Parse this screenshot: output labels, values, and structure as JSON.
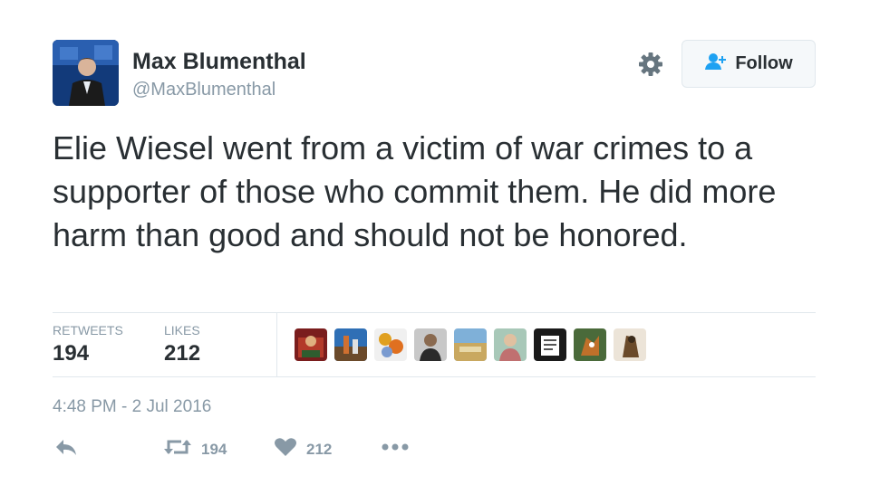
{
  "user": {
    "name": "Max Blumenthal",
    "handle": "@MaxBlumenthal"
  },
  "follow_button": {
    "label": "Follow"
  },
  "tweet": {
    "text": "Elie Wiesel went from a victim of war crimes to a supporter of those who commit them. He did more harm than good and should not be honored."
  },
  "stats": {
    "retweets_label": "RETWEETS",
    "retweets_value": "194",
    "likes_label": "LIKES",
    "likes_value": "212"
  },
  "likers": [
    "liker-avatar",
    "liker-avatar",
    "liker-avatar",
    "liker-avatar",
    "liker-avatar",
    "liker-avatar",
    "liker-avatar",
    "liker-avatar",
    "liker-avatar"
  ],
  "timestamp": "4:48 PM - 2 Jul 2016",
  "actions": {
    "retweet_count": "194",
    "like_count": "212"
  },
  "colors": {
    "text": "#292f33",
    "muted": "#8899a6",
    "follow_icon": "#1da1f2",
    "border": "#e1e8ed"
  },
  "icons": {
    "settings": "gear-icon",
    "follow": "add-user-icon",
    "reply": "reply-icon",
    "retweet": "retweet-icon",
    "like": "heart-icon",
    "more": "more-icon"
  }
}
